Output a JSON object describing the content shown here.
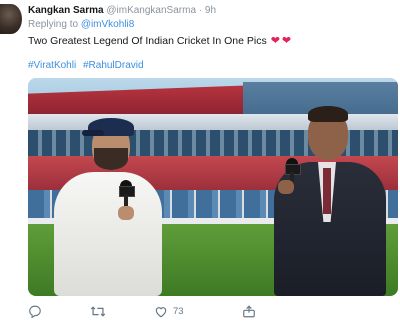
{
  "tweet": {
    "author_name": "Kangkan Sarma",
    "author_handle": "@imKangkanSarma",
    "separator": "·",
    "time": "9h",
    "reply_prefix": "Replying to",
    "reply_handle": "@imVkohli8",
    "text": "Two Greatest Legend Of Indian Cricket In One Pics",
    "emojis": [
      "heart-emoji",
      "heart-emoji"
    ],
    "hashtags": [
      "#ViratKohli",
      "#RahulDravid"
    ],
    "likes": "73"
  },
  "icons": {
    "reply": "reply-icon",
    "retweet": "retweet-icon",
    "like": "heart-icon",
    "share": "share-icon"
  },
  "colors": {
    "link": "#3d8fe0",
    "heart": "#e0245e",
    "muted": "#8a949d"
  }
}
